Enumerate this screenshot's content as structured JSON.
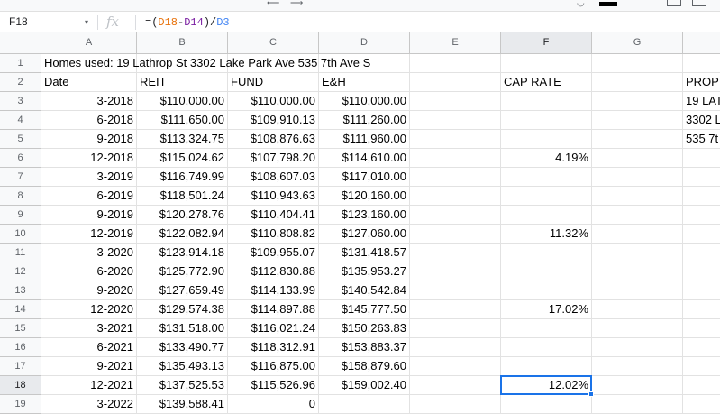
{
  "name_box": "F18",
  "formula": {
    "prefix": "=(",
    "ref1": "D18",
    "minus": "-",
    "ref2": "D14",
    "close": ")/",
    "ref3": "D3",
    "ref1_color": "#e8710a",
    "ref2_color": "#7b1fa2",
    "ref3_color": "#4285f4"
  },
  "icons": {
    "fx": "fx",
    "namebox_caret": "▾"
  },
  "columns": [
    "A",
    "B",
    "C",
    "D",
    "E",
    "F",
    "G",
    ""
  ],
  "selected_cell": {
    "col": "F",
    "row": "18"
  },
  "row1_title": "Homes used: 19 Lathrop St 3302 Lake Park Ave 535 7th Ave S",
  "headers": {
    "date": "Date",
    "reit": "REIT",
    "fund": "FUND",
    "eh": "E&H",
    "cap_rate": "CAP RATE",
    "prop": "PROP"
  },
  "property_list": [
    "19 LAT",
    "3302 L",
    "535 7t"
  ],
  "rows": [
    {
      "n": "3",
      "date": "3-2018",
      "reit": "$110,000.00",
      "fund": "$110,000.00",
      "eh": "$110,000.00",
      "cap": ""
    },
    {
      "n": "4",
      "date": "6-2018",
      "reit": "$111,650.00",
      "fund": "$109,910.13",
      "eh": "$111,260.00",
      "cap": ""
    },
    {
      "n": "5",
      "date": "9-2018",
      "reit": "$113,324.75",
      "fund": "$108,876.63",
      "eh": "$111,960.00",
      "cap": ""
    },
    {
      "n": "6",
      "date": "12-2018",
      "reit": "$115,024.62",
      "fund": "$107,798.20",
      "eh": "$114,610.00",
      "cap": "4.19%"
    },
    {
      "n": "7",
      "date": "3-2019",
      "reit": "$116,749.99",
      "fund": "$108,607.03",
      "eh": "$117,010.00",
      "cap": ""
    },
    {
      "n": "8",
      "date": "6-2019",
      "reit": "$118,501.24",
      "fund": "$110,943.63",
      "eh": "$120,160.00",
      "cap": ""
    },
    {
      "n": "9",
      "date": "9-2019",
      "reit": "$120,278.76",
      "fund": "$110,404.41",
      "eh": "$123,160.00",
      "cap": ""
    },
    {
      "n": "10",
      "date": "12-2019",
      "reit": "$122,082.94",
      "fund": "$110,808.82",
      "eh": "$127,060.00",
      "cap": "11.32%"
    },
    {
      "n": "11",
      "date": "3-2020",
      "reit": "$123,914.18",
      "fund": "$109,955.07",
      "eh": "$131,418.57",
      "cap": ""
    },
    {
      "n": "12",
      "date": "6-2020",
      "reit": "$125,772.90",
      "fund": "$112,830.88",
      "eh": "$135,953.27",
      "cap": ""
    },
    {
      "n": "13",
      "date": "9-2020",
      "reit": "$127,659.49",
      "fund": "$114,133.99",
      "eh": "$140,542.84",
      "cap": ""
    },
    {
      "n": "14",
      "date": "12-2020",
      "reit": "$129,574.38",
      "fund": "$114,897.88",
      "eh": "$145,777.50",
      "cap": "17.02%"
    },
    {
      "n": "15",
      "date": "3-2021",
      "reit": "$131,518.00",
      "fund": "$116,021.24",
      "eh": "$150,263.83",
      "cap": ""
    },
    {
      "n": "16",
      "date": "6-2021",
      "reit": "$133,490.77",
      "fund": "$118,312.91",
      "eh": "$153,883.37",
      "cap": ""
    },
    {
      "n": "17",
      "date": "9-2021",
      "reit": "$135,493.13",
      "fund": "$116,875.00",
      "eh": "$158,879.60",
      "cap": ""
    },
    {
      "n": "18",
      "date": "12-2021",
      "reit": "$137,525.53",
      "fund": "$115,526.96",
      "eh": "$159,002.40",
      "cap": "12.02%"
    },
    {
      "n": "19",
      "date": "3-2022",
      "reit": "$139,588.41",
      "fund": "0",
      "eh": "",
      "cap": ""
    }
  ]
}
